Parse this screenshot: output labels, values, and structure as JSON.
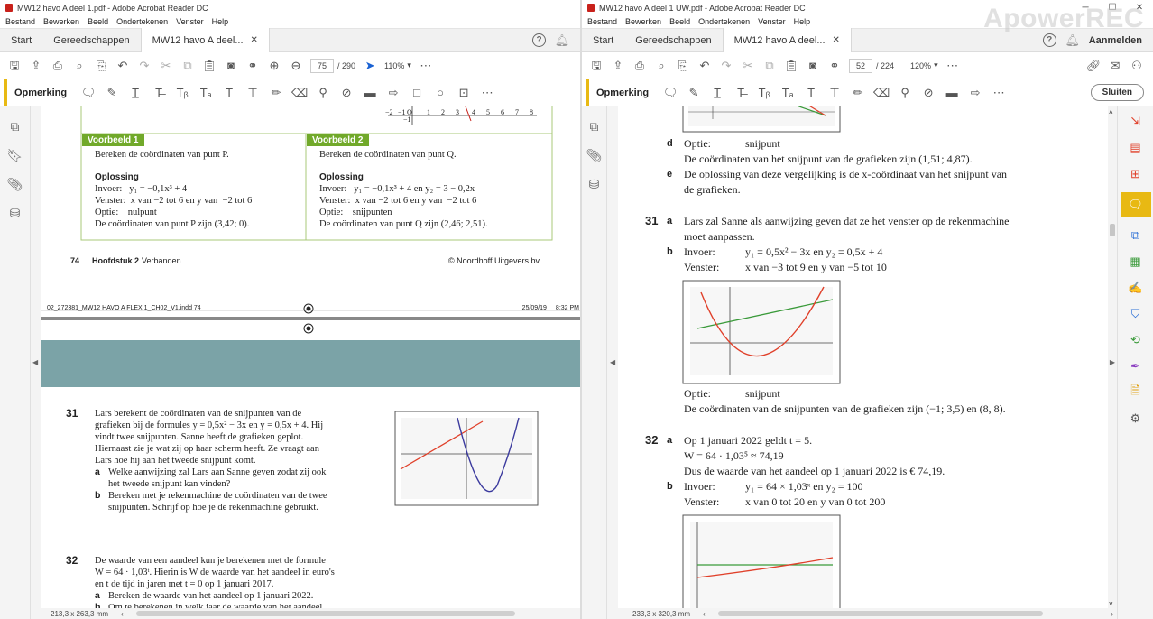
{
  "left": {
    "title": "MW12 havo A deel 1.pdf - Adobe Acrobat Reader DC",
    "menu": [
      "Bestand",
      "Bewerken",
      "Beeld",
      "Ondertekenen",
      "Venster",
      "Help"
    ],
    "tabs": {
      "start": "Start",
      "tools": "Gereedschappen",
      "doc": "MW12 havo A deel..."
    },
    "page_current": "75",
    "page_total": "/ 290",
    "zoom": "110%",
    "comment_label": "Opmerking",
    "status": "213,3 x 263,3 mm",
    "example1": {
      "head": "Voorbeeld 1",
      "task": "Bereken de coördinaten van punt P.",
      "sol": "Oplossing",
      "l1": "Invoer:   y₁ = −0,1x³ + 4",
      "l2": "Venster:  x van −2 tot 6 en y van  −2 tot 6",
      "l3": "Optie:    nulpunt",
      "l4": "De coördinaten van punt P zijn (3,42; 0)."
    },
    "example2": {
      "head": "Voorbeeld 2",
      "task": "Bereken de coördinaten van punt Q.",
      "sol": "Oplossing",
      "l1": "Invoer:   y₁ = −0,1x³ + 4 en y₂ = 3 − 0,2x",
      "l2": "Venster:  x van −2 tot 6 en y van  −2 tot 6",
      "l3": "Optie:    snijpunten",
      "l4": "De coördinaten van punt Q zijn (2,46; 2,51)."
    },
    "axis_ticks": [
      "−2",
      "−1",
      "O",
      "1",
      "2",
      "3",
      "4",
      "5",
      "6",
      "7",
      "8"
    ],
    "axis_tick_below": "−1",
    "footer_page": "74",
    "footer_chapter": "Hoofdstuk 2",
    "footer_topic": "Verbanden",
    "footer_copy": "© Noordhoff Uitgevers bv",
    "print_left": "02_272381_MW12 HAVO A FLEX 1_CH02_V1.indd  74",
    "print_date": "25/09/19",
    "print_time": "8:32 PM",
    "q31": {
      "num": "31",
      "l1": "Lars berekent de coördinaten van de snijpunten van de",
      "l2": "grafieken bij de formules y = 0,5x² − 3x en y = 0,5x + 4. Hij",
      "l3": "vindt twee snijpunten. Sanne heeft de grafieken geplot.",
      "l4": "Hiernaast zie je wat zij op haar scherm heeft. Ze vraagt aan",
      "l5": "Lars hoe hij aan het tweede snijpunt komt.",
      "a_label": "a",
      "a1": "Welke aanwijzing zal Lars aan Sanne geven zodat zij ook",
      "a2": "het tweede snijpunt kan vinden?",
      "b_label": "b",
      "b1": "Bereken met je rekenmachine de coördinaten van de twee",
      "b2": "snijpunten. Schrijf op hoe je de rekenmachine gebruikt."
    },
    "q32": {
      "num": "32",
      "l1": "De waarde van een aandeel kun je berekenen met de formule",
      "l2": "W = 64 · 1,03ᵗ. Hierin is W de waarde van het aandeel in euro's",
      "l3": "en t de tijd in jaren met t = 0 op 1 januari 2017.",
      "a_label": "a",
      "a1": "Bereken de waarde van het aandeel op 1 januari 2022.",
      "b_label": "b",
      "b1": "Om te berekenen in welk jaar de waarde van het aandeel"
    }
  },
  "right": {
    "title": "MW12 havo A deel 1 UW.pdf - Adobe Acrobat Reader DC",
    "menu": [
      "Bestand",
      "Bewerken",
      "Beeld",
      "Ondertekenen",
      "Venster",
      "Help"
    ],
    "tabs": {
      "start": "Start",
      "tools": "Gereedschappen",
      "doc": "MW12 havo A deel..."
    },
    "signin": "Aanmelden",
    "page_current": "52",
    "page_total": "/ 224",
    "zoom": "120%",
    "comment_label": "Opmerking",
    "close_label": "Sluiten",
    "status": "233,3 x 320,3 mm",
    "watermark": "ApowerREC",
    "d_label": "d",
    "d_optie": "Optie:",
    "d_optie_val": "snijpunt",
    "d_line": "De coördinaten van het snijpunt van de grafieken zijn (1,51; 4,87).",
    "e_label": "e",
    "e1": "De oplossing van deze vergelijking is de x-coördinaat van het snijpunt van",
    "e2": "de grafieken.",
    "q31_num": "31",
    "q31a_label": "a",
    "q31a1": "Lars zal Sanne als aanwijzing geven dat ze het venster op de rekenmachine",
    "q31a2": "moet aanpassen.",
    "q31b_label": "b",
    "q31b_invoer": "Invoer:",
    "q31b_invoer_val": "y₁ = 0,5x² − 3x en y₂ = 0,5x + 4",
    "q31b_venster": "Venster:",
    "q31b_venster_val": "x van −3 tot 9 en y van −5 tot 10",
    "q31_optie": "Optie:",
    "q31_optie_val": "snijpunt",
    "q31_result": "De coördinaten van de snijpunten van de grafieken zijn (−1; 3,5) en (8, 8).",
    "q32_num": "32",
    "q32a_label": "a",
    "q32a1": "Op 1 januari 2022 geldt t = 5.",
    "q32a2": "W = 64 · 1,03⁵ ≈ 74,19",
    "q32a3": "Dus de waarde van het aandeel op 1 januari 2022 is € 74,19.",
    "q32b_label": "b",
    "q32b_invoer": "Invoer:",
    "q32b_invoer_val": "y₁ = 64 × 1,03ˣ en y₂ = 100",
    "q32b_venster": "Venster:",
    "q32b_venster_val": "x van 0 tot 20 en y van 0 tot 200"
  },
  "colors": {
    "acrobat_red": "#c8211b",
    "accent_yellow": "#e8b913",
    "example_green": "#71a92a",
    "chapter_band": "#7ba3a7",
    "graph_red": "#e0402a",
    "graph_green": "#3a9a3a",
    "graph_blue": "#3b3a9e"
  }
}
